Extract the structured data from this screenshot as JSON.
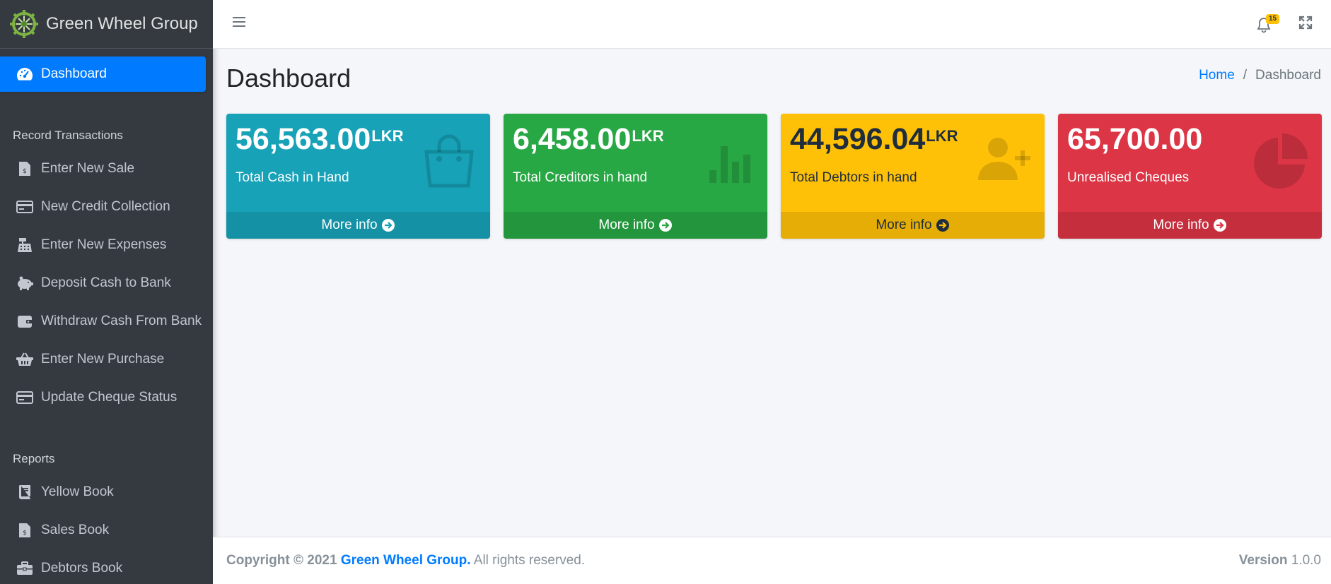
{
  "brand": {
    "name": "Green Wheel Group",
    "logo_icon": "gear-wheel-logo"
  },
  "sidebar": {
    "active_item": {
      "label": "Dashboard",
      "icon": "tachometer-icon"
    },
    "section_transactions": "Record Transactions",
    "transactions": [
      {
        "label": "Enter New Sale",
        "icon": "invoice-icon"
      },
      {
        "label": "New Credit Collection",
        "icon": "credit-card-icon"
      },
      {
        "label": "Enter New Expenses",
        "icon": "cash-register-icon"
      },
      {
        "label": "Deposit Cash to Bank",
        "icon": "piggy-bank-icon"
      },
      {
        "label": "Withdraw Cash From Bank",
        "icon": "wallet-icon"
      },
      {
        "label": "Enter New Purchase",
        "icon": "basket-icon"
      },
      {
        "label": "Update Cheque Status",
        "icon": "credit-card-icon"
      }
    ],
    "section_reports": "Reports",
    "reports": [
      {
        "label": "Yellow Book",
        "icon": "book-icon"
      },
      {
        "label": "Sales Book",
        "icon": "invoice-icon"
      },
      {
        "label": "Debtors Book",
        "icon": "briefcase-icon"
      }
    ]
  },
  "topbar": {
    "notification_count": "15"
  },
  "header": {
    "title": "Dashboard",
    "breadcrumb_home": "Home",
    "breadcrumb_sep": "/",
    "breadcrumb_current": "Dashboard"
  },
  "boxes": [
    {
      "value": "56,563.00",
      "unit": "LKR",
      "label": "Total Cash in Hand",
      "footer": "More info",
      "color": "#17a2b8",
      "icon": "shopping-bag-icon"
    },
    {
      "value": "6,458.00",
      "unit": "LKR",
      "label": "Total Creditors in hand",
      "footer": "More info",
      "color": "#28a745",
      "icon": "bar-chart-icon"
    },
    {
      "value": "44,596.04",
      "unit": "LKR",
      "label": "Total Debtors in hand",
      "footer": "More info",
      "color": "#ffc107",
      "icon": "user-plus-icon"
    },
    {
      "value": "65,700.00",
      "unit": "",
      "label": "Unrealised Cheques",
      "footer": "More info",
      "color": "#dc3545",
      "icon": "pie-chart-icon"
    }
  ],
  "footer": {
    "copyright": "Copyright © 2021",
    "company": "Green Wheel Group.",
    "rights": "All rights reserved.",
    "version_label": "Version",
    "version": "1.0.0"
  }
}
